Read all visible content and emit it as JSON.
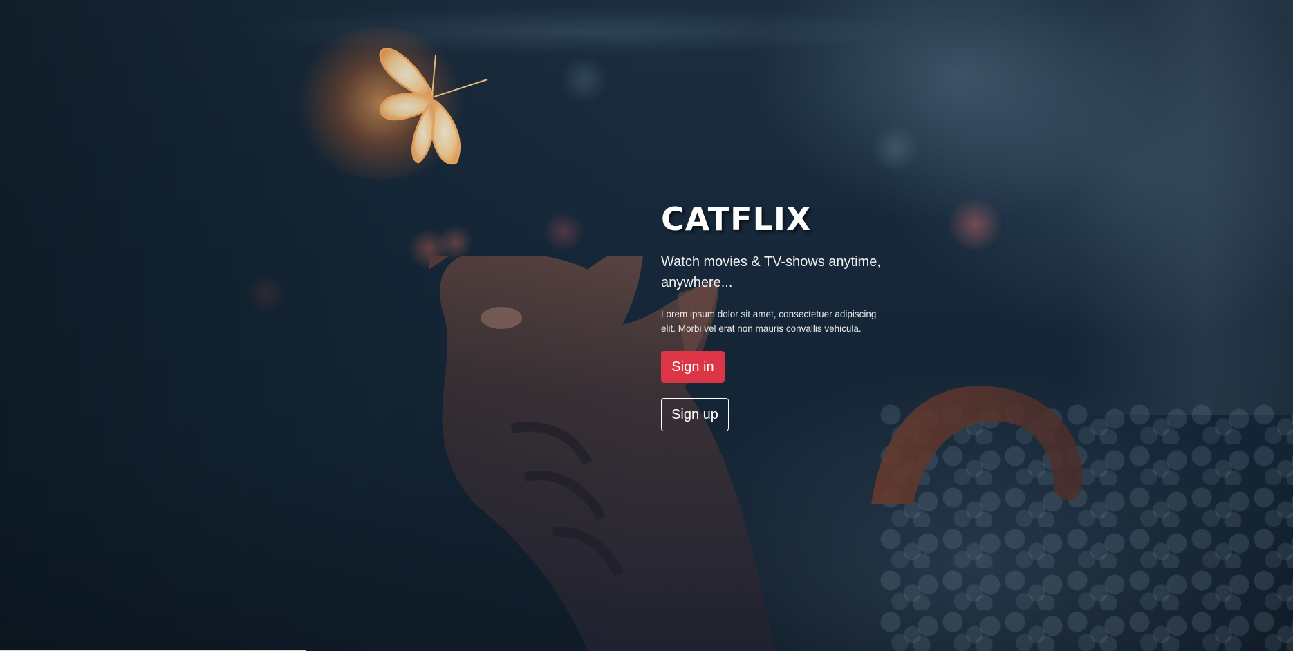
{
  "hero": {
    "brand": "CATFLIX",
    "tagline": "Watch movies & TV-shows anytime, anywhere...",
    "description": "Lorem ipsum dolor sit amet, consectetuer adipiscing elit. Morbi vel erat non mauris convallis vehicula.",
    "signin_label": "Sign in",
    "signup_label": "Sign up"
  },
  "colors": {
    "accent": "#dc3545",
    "background": "#16283a",
    "glow": "#ffaa5a",
    "text": "#ffffff"
  },
  "background_image": {
    "subject": "cat looking up at glowing butterfly"
  }
}
